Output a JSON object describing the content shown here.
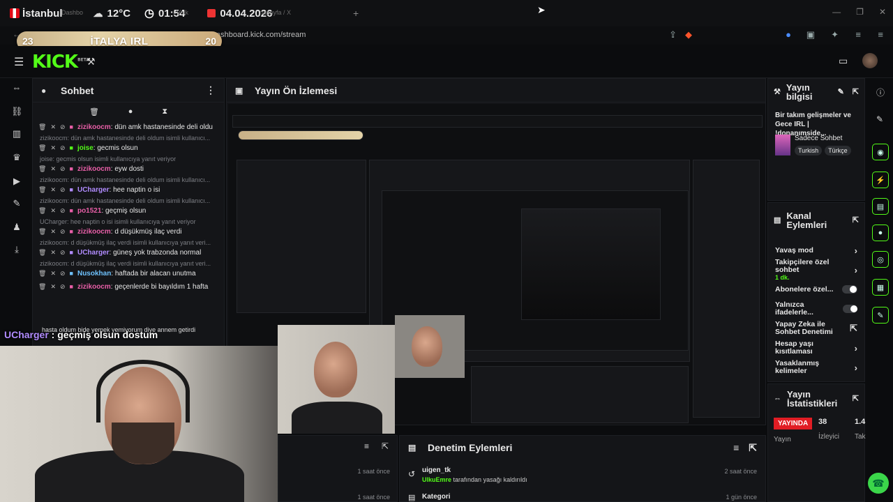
{
  "topbar": {
    "city": "İstanbul",
    "weather": "12°C",
    "time": "01:54",
    "date": "04.04.2026",
    "faded_tab1": "Dashbo",
    "faded_tab2": "ı Volk",
    "faded_tab3": "nasayfa / X"
  },
  "address": {
    "url": "ashboard.kick.com/stream"
  },
  "scoreboard": {
    "left": "23",
    "title": "İTALYA IRL",
    "right": "20"
  },
  "header": {
    "logo": "KICK",
    "beta": "BETA"
  },
  "chat": {
    "title": "Sohbet",
    "messages": [
      {
        "type": "msg",
        "user": "zizikoocm",
        "color": "#e95fa8",
        "text": ": dün amk hastanesinde deli oldu"
      },
      {
        "type": "reply",
        "text": "zizikoocm: dün amk hastanesinde deli oldum isimli kullanıcı..."
      },
      {
        "type": "msg",
        "user": "joise",
        "color": "#53fc18",
        "text": ": gecmis olsun"
      },
      {
        "type": "reply",
        "text": "joise: gecmis olsun isimli kullanıcıya yanıt veriyor"
      },
      {
        "type": "msg",
        "user": "zizikoocm",
        "color": "#e95fa8",
        "text": ": eyw dosti"
      },
      {
        "type": "reply",
        "text": "zizikoocm: dün amk hastanesinde deli oldum isimli kullanıcı..."
      },
      {
        "type": "msg",
        "user": "UCharger",
        "color": "#b18cff",
        "text": ": hee naptin o isi"
      },
      {
        "type": "reply",
        "text": "zizikoocm: dün amk hastanesinde deli oldum isimli kullanıcı..."
      },
      {
        "type": "msg",
        "user": "po1521",
        "color": "#e95fa8",
        "text": ": geçmiş olsun"
      },
      {
        "type": "reply",
        "text": "UCharger: hee naptin o isi isimli kullanıcıya yanıt veriyor"
      },
      {
        "type": "msg",
        "user": "zizikoocm",
        "color": "#e95fa8",
        "text": ": d düşükmüş ilaç verdi"
      },
      {
        "type": "reply",
        "text": "zizikoocm: d düşükmüş ilaç verdi isimli kullanıcıya yanıt veri..."
      },
      {
        "type": "msg",
        "user": "UCharger",
        "color": "#b18cff",
        "text": ": güneş yok trabzonda normal"
      },
      {
        "type": "reply",
        "text": "zizikoocm: d düşükmüş ilaç verdi isimli kullanıcıya yanıt veri..."
      },
      {
        "type": "msg",
        "user": "Nusokhan",
        "color": "#6fc3ff",
        "text": ": haftada bir alacan unutma"
      },
      {
        "type": "msg",
        "user": "zizikoocm",
        "color": "#e95fa8",
        "text": ": geçenlerde bi bayıldım 1 hafta"
      }
    ],
    "overlay_user": "UCharger",
    "overlay_text": " : geçmiş olsun dostum",
    "overlay_sub": "hasta oldum bide yemek yemiyorum diye annem getirdi",
    "overlay_sub2": "UCharger: geçmiş olsun dostum"
  },
  "preview": {
    "title": "Yayın Ön İzlemesi"
  },
  "stream_info": {
    "title": "Yayın bilgisi",
    "desc": "Bir takım gelişmeler ve Gece IRL | !donanımside...",
    "category": "Sadece Sohbet",
    "tags": [
      "Turkish",
      "Türkçe"
    ]
  },
  "channel_actions": {
    "title": "Kanal Eylemleri",
    "items": [
      {
        "label": "Yavaş mod",
        "control": "chevron"
      },
      {
        "label": "Takipçilere özel sohbet",
        "sub": "1 dk.",
        "control": "chevron"
      },
      {
        "label": "Abonelere özel...",
        "control": "toggle"
      },
      {
        "label": "Yalnızca ifadelerle...",
        "control": "toggle"
      },
      {
        "label": "Yapay Zeka ile Sohbet Denetimi",
        "control": "external"
      },
      {
        "label": "Hesap yaşı kısıtlaması",
        "control": "chevron"
      },
      {
        "label": "Yasaklanmış kelimeler",
        "control": "chevron"
      }
    ]
  },
  "stats": {
    "title": "Yayın İstatistikleri",
    "live": "YAYINDA",
    "live_label": "Yayın",
    "viewers": "38",
    "viewers_label": "İzleyici",
    "third": "1.4",
    "third_label": "Tak"
  },
  "moderation": {
    "title": "Denetim Eylemleri",
    "rows": [
      {
        "user": "uigen_tk",
        "by": "UlkuEmre",
        "action": " tarafından yasağı kaldırıldı",
        "time": "2 saat önce"
      },
      {
        "user": "Kategori",
        "by": "",
        "action": "",
        "time": "1 gün önce"
      }
    ]
  },
  "left_bottom": {
    "time1": "1 saat önce",
    "time2": "1 saat önce"
  },
  "colors": {
    "brand": "#53fc18",
    "live": "#e11d24"
  }
}
